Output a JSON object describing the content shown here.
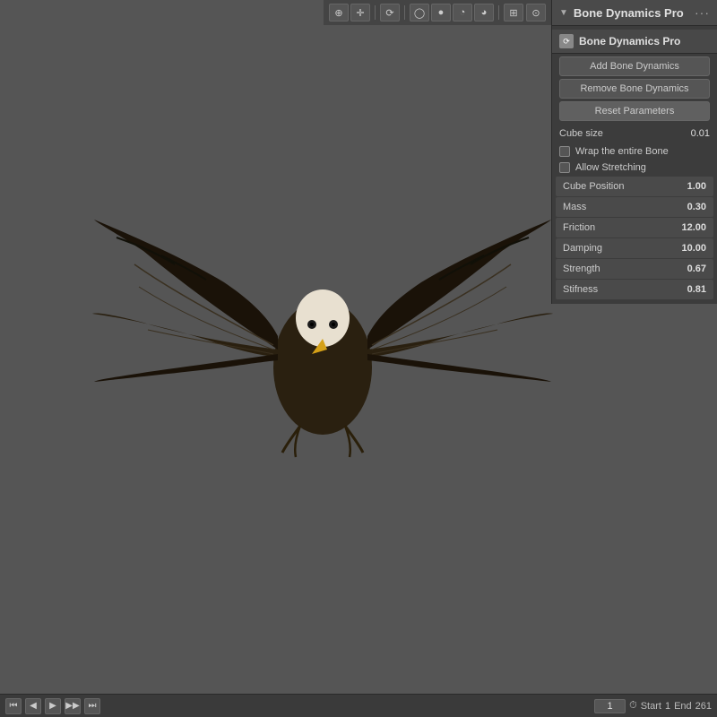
{
  "viewport": {
    "background": "#555555"
  },
  "toolbar": {
    "icons": [
      "cursor-icon",
      "transform-icon",
      "pivot-icon",
      "shading-icon",
      "overlay-icon",
      "gizmo-icon",
      "view-icon"
    ]
  },
  "panel": {
    "title": "Bone Dynamics Pro",
    "collapse_icon": "▼",
    "dots": "···",
    "section_icon": "⟳",
    "section_label": "Bone Dynamics Pro",
    "buttons": {
      "add": "Add Bone Dynamics",
      "remove": "Remove Bone Dynamics",
      "reset": "Reset Parameters"
    },
    "cube_size_label": "Cube size",
    "cube_size_value": "0.01",
    "wrap_label": "Wrap the entire Bone",
    "allow_stretch_label": "Allow Stretching",
    "fields": [
      {
        "label": "Cube Position",
        "value": "1.00"
      },
      {
        "label": "Mass",
        "value": "0.30"
      },
      {
        "label": "Friction",
        "value": "12.00"
      },
      {
        "label": "Damping",
        "value": "10.00"
      },
      {
        "label": "Strength",
        "value": "0.67"
      },
      {
        "label": "Stifness",
        "value": "0.81"
      }
    ]
  },
  "bottom_bar": {
    "frame_current": "1",
    "start_label": "Start",
    "start_value": "1",
    "end_label": "End",
    "end_value": "261"
  }
}
